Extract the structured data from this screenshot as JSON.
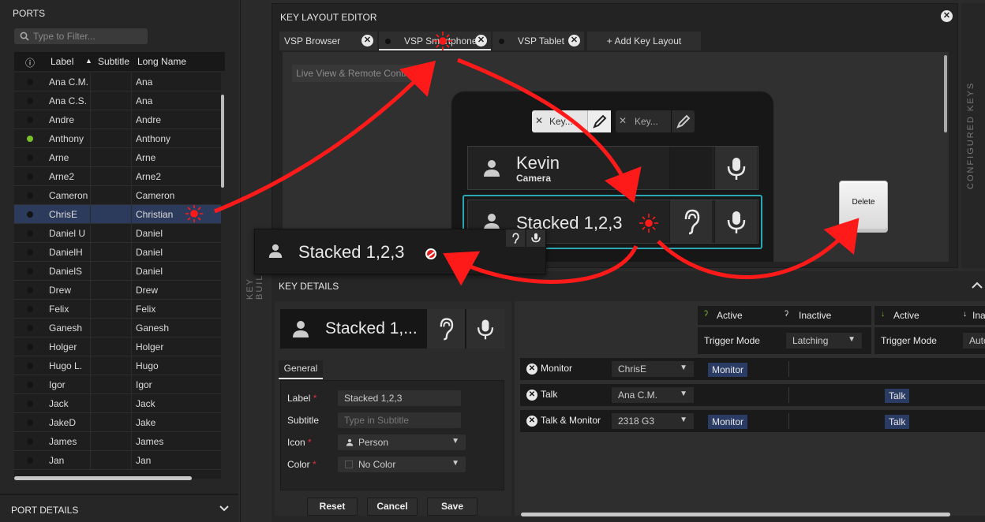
{
  "ports": {
    "title": "PORTS",
    "filter_placeholder": "Type to Filter...",
    "columns": {
      "info": "ⓘ",
      "label": "Label",
      "subtitle": "Subtitle",
      "long_name": "Long Name"
    },
    "rows": [
      {
        "label": "Ana C.M.",
        "long_name": "Ana",
        "status": "offline"
      },
      {
        "label": "Ana C.S.",
        "long_name": "Ana",
        "status": "offline"
      },
      {
        "label": "Andre",
        "long_name": "Andre",
        "status": "offline"
      },
      {
        "label": "Anthony",
        "long_name": "Anthony",
        "status": "online"
      },
      {
        "label": "Arne",
        "long_name": "Arne",
        "status": "offline"
      },
      {
        "label": "Arne2",
        "long_name": "Arne2",
        "status": "offline"
      },
      {
        "label": "Cameron",
        "long_name": "Cameron",
        "status": "offline"
      },
      {
        "label": "ChrisE",
        "long_name": "Christian",
        "status": "offline",
        "selected": true
      },
      {
        "label": "Daniel U",
        "long_name": "Daniel",
        "status": "offline"
      },
      {
        "label": "DanielH",
        "long_name": "Daniel",
        "status": "offline"
      },
      {
        "label": "DanielS",
        "long_name": "Daniel",
        "status": "offline"
      },
      {
        "label": "Drew",
        "long_name": "Drew",
        "status": "offline"
      },
      {
        "label": "Felix",
        "long_name": "Felix",
        "status": "offline"
      },
      {
        "label": "Ganesh",
        "long_name": "Ganesh",
        "status": "offline"
      },
      {
        "label": "Holger",
        "long_name": "Holger",
        "status": "offline"
      },
      {
        "label": "Hugo L.",
        "long_name": "Hugo",
        "status": "offline"
      },
      {
        "label": "Igor",
        "long_name": "Igor",
        "status": "offline"
      },
      {
        "label": "Jack",
        "long_name": "Jack",
        "status": "offline"
      },
      {
        "label": "JakeD",
        "long_name": "Jake",
        "status": "offline"
      },
      {
        "label": "James",
        "long_name": "James",
        "status": "offline"
      },
      {
        "label": "Jan",
        "long_name": "Jan",
        "status": "offline"
      }
    ],
    "status_colors": {
      "online": "#7bc12b",
      "offline": "#141414"
    }
  },
  "port_details": {
    "title": "PORT DETAILS"
  },
  "key_builder_label": "KEY BUILDER",
  "editor": {
    "title": "KEY LAYOUT EDITOR",
    "tabs": [
      {
        "label": "VSP Browser"
      },
      {
        "label": "VSP Smartphone",
        "active": true
      },
      {
        "label": "VSP Tablet"
      }
    ],
    "add_layout": "+ Add Key Layout",
    "live_view": "Live View & Remote Control",
    "chips": [
      {
        "label": "Key..."
      },
      {
        "label": "Key..."
      }
    ],
    "keys": [
      {
        "name": "Kevin",
        "subtitle": "Camera"
      },
      {
        "name": "Stacked 1,2,3"
      }
    ],
    "delete_label": "Delete"
  },
  "configured_keys_label": "CONFIGURED KEYS",
  "drag_ghost": {
    "name": "Stacked 1,2,3"
  },
  "key_details": {
    "title": "KEY DETAILS",
    "preview_name": "Stacked 1,...",
    "tab": "General",
    "form": {
      "label_caption": "Label",
      "label_value": "Stacked 1,2,3",
      "subtitle_caption": "Subtitle",
      "subtitle_placeholder": "Type in Subtitle",
      "icon_caption": "Icon",
      "icon_value": "Person",
      "color_caption": "Color",
      "color_value": "No Color"
    },
    "buttons": {
      "reset": "Reset",
      "cancel": "Cancel",
      "save": "Save"
    },
    "listen_header": {
      "active": "Active",
      "inactive": "Inactive",
      "trigger_caption": "Trigger Mode",
      "trigger_value": "Latching"
    },
    "talk_header": {
      "active": "Active",
      "inactive": "Ina",
      "trigger_caption": "Trigger Mode",
      "trigger_value": "Auto"
    },
    "rows": [
      {
        "type": "Monitor",
        "port": "ChrisE",
        "listen_badge": "Monitor",
        "talk_badge": ""
      },
      {
        "type": "Talk",
        "port": "Ana C.M.",
        "listen_badge": "",
        "talk_badge": "Talk"
      },
      {
        "type": "Talk & Monitor",
        "port": "2318 G3",
        "listen_badge": "Monitor",
        "talk_badge": "Talk"
      }
    ]
  },
  "colors": {
    "accent_teal": "#2aa7b3",
    "selection": "#2c3a5c",
    "badge": "#2a3b64",
    "annotation_red": "#ff1a1a",
    "required": "#e0303a"
  }
}
